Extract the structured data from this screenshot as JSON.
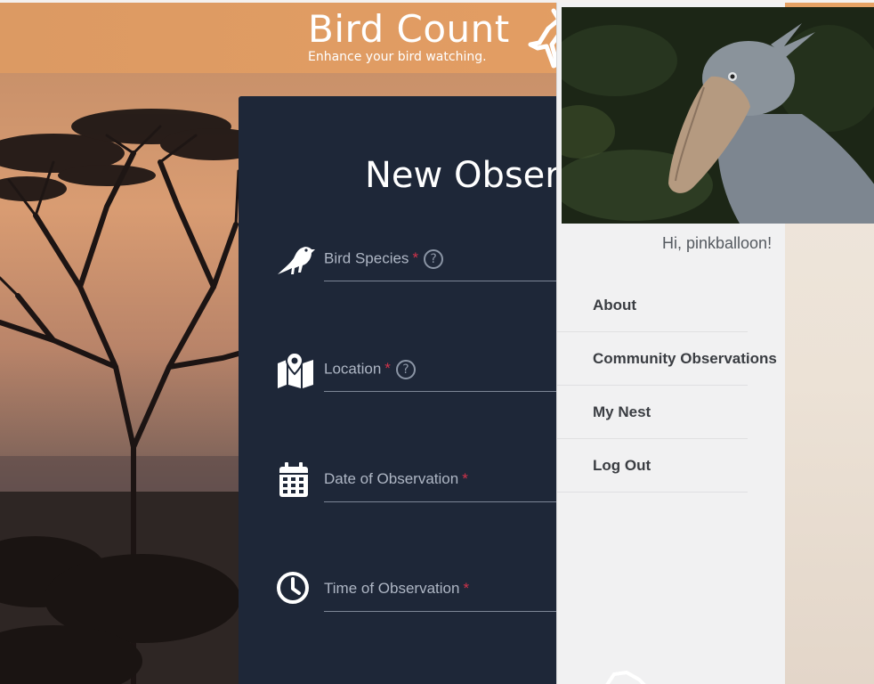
{
  "header": {
    "title": "Bird Count",
    "tagline": "Enhance your bird watching."
  },
  "form": {
    "title": "New Obser",
    "fields": [
      {
        "label": "Bird Species",
        "required": "*",
        "help": "?",
        "icon": "bird-icon"
      },
      {
        "label": "Location",
        "required": "*",
        "help": "?",
        "icon": "map-pin-icon"
      },
      {
        "label": "Date of Observation",
        "required": "*",
        "icon": "calendar-icon"
      },
      {
        "label": "Time of Observation",
        "required": "*",
        "icon": "clock-icon"
      }
    ]
  },
  "menu": {
    "greeting": "Hi, pinkballoon!",
    "items": [
      {
        "label": "About"
      },
      {
        "label": "Community Observations"
      },
      {
        "label": "My Nest"
      },
      {
        "label": "Log Out"
      }
    ]
  },
  "colors": {
    "header": "#e29d63",
    "card": "#1e2738",
    "required": "#d0334a",
    "menu_bg": "#f1f1f2"
  }
}
